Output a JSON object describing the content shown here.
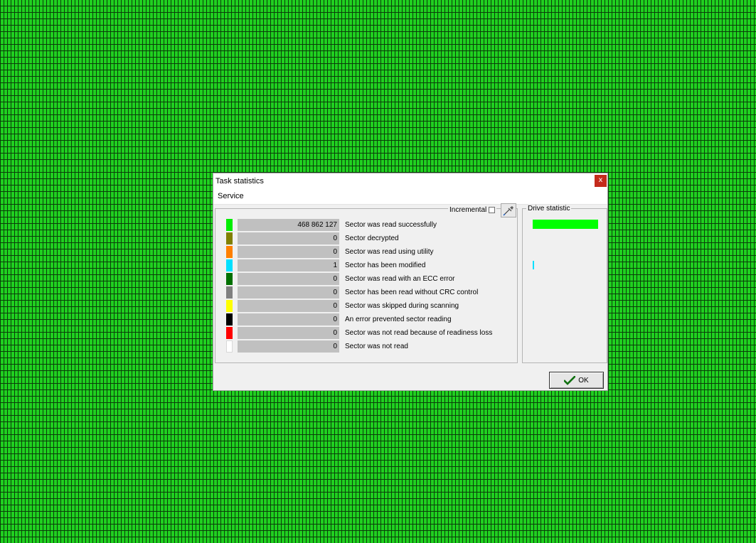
{
  "window": {
    "title": "Task statistics",
    "close_label": "x"
  },
  "menu": {
    "service": "Service"
  },
  "options": {
    "incremental_label": "Incremental",
    "incremental_checked": false
  },
  "stats": {
    "rows": [
      {
        "color": "#00ee00",
        "count": "468 862 127",
        "label": "Sector was read successfully"
      },
      {
        "color": "#808000",
        "count": "0",
        "label": "Sector decrypted"
      },
      {
        "color": "#ff8000",
        "count": "0",
        "label": "Sector was read using utility"
      },
      {
        "color": "#00e0ff",
        "count": "1",
        "label": "Sector has been modified"
      },
      {
        "color": "#007000",
        "count": "0",
        "label": "Sector was read with an ECC error"
      },
      {
        "color": "#808080",
        "count": "0",
        "label": "Sector has been read without CRC control"
      },
      {
        "color": "#ffff00",
        "count": "0",
        "label": "Sector was skipped during scanning"
      },
      {
        "color": "#000000",
        "count": "0",
        "label": "An error prevented sector reading"
      },
      {
        "color": "#ff0000",
        "count": "0",
        "label": "Sector was not read because of readiness loss"
      },
      {
        "color": "#ffffff",
        "count": "0",
        "label": "Sector was not read"
      }
    ]
  },
  "drive": {
    "title": "Drive statistic",
    "bar_color": "#00ff00",
    "mark_color": "#00e0ff"
  },
  "footer": {
    "ok_label": "OK"
  },
  "icons": {
    "tool": "pipette-icon",
    "ok": "checkmark-icon",
    "close": "close-icon"
  }
}
